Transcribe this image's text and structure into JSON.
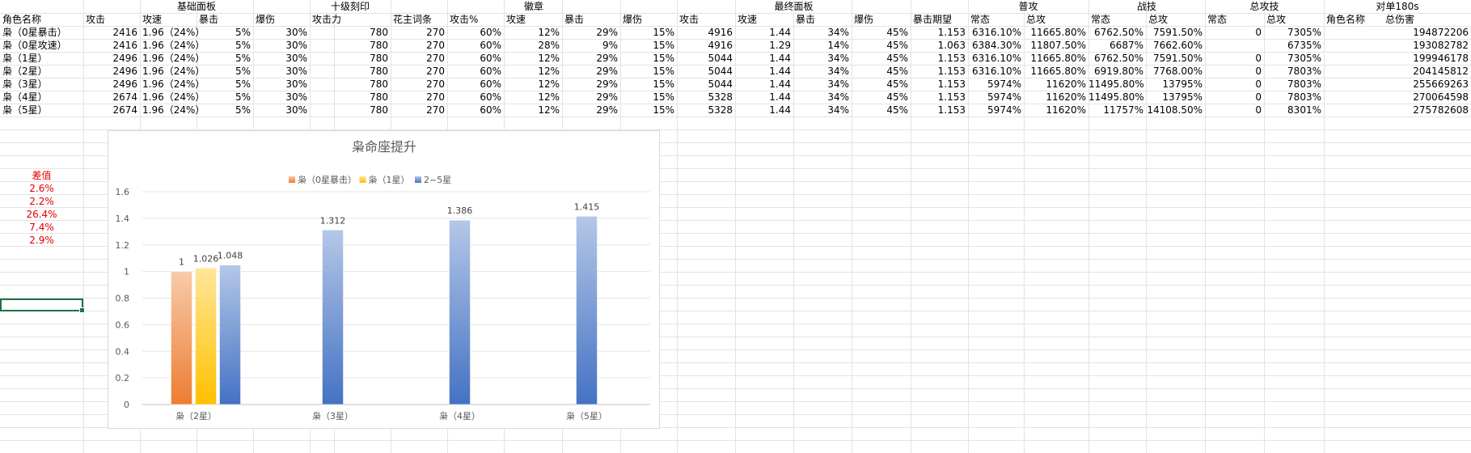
{
  "headers_top": [
    {
      "label": "基础面板",
      "col": 1,
      "span": 4
    },
    {
      "label": "十级刻印",
      "col": 5,
      "span": 1
    },
    {
      "label": "徽章",
      "col": 6,
      "span": 5
    },
    {
      "label": "最终面板",
      "col": 11,
      "span": 4
    },
    {
      "label": "普攻",
      "col": 16,
      "span": 2
    },
    {
      "label": "战技",
      "col": 18,
      "span": 2
    },
    {
      "label": "总攻技",
      "col": 20,
      "span": 2
    },
    {
      "label": "对单180s",
      "col": 22,
      "span": 2
    }
  ],
  "headers_sub": [
    "角色名称",
    "攻击",
    "攻速",
    "暴击",
    "爆伤",
    "攻击力",
    "花主词条",
    "攻击%",
    "攻速",
    "暴击",
    "爆伤",
    "攻击",
    "攻速",
    "暴击",
    "爆伤",
    "暴击期望",
    "常态",
    "总攻",
    "常态",
    "总攻",
    "常态",
    "总攻",
    "角色名称",
    "总伤害"
  ],
  "rows": [
    [
      "枭（0星暴击）",
      "2416",
      "1.96（24%）",
      "5%",
      "30%",
      "780",
      "270",
      "60%",
      "12%",
      "29%",
      "15%",
      "4916",
      "1.44",
      "34%",
      "45%",
      "1.153",
      "6316.10%",
      "11665.80%",
      "6762.50%",
      "7591.50%",
      "0",
      "7305%",
      "",
      "194872206"
    ],
    [
      "枭（0星攻速）",
      "2416",
      "1.96（24%）",
      "5%",
      "30%",
      "780",
      "270",
      "60%",
      "28%",
      "9%",
      "15%",
      "4916",
      "1.29",
      "14%",
      "45%",
      "1.063",
      "6384.30%",
      "11807.50%",
      "6687%",
      "7662.60%",
      "",
      "6735%",
      "",
      "193082782"
    ],
    [
      "枭（1星）",
      "2496",
      "1.96（24%）",
      "5%",
      "30%",
      "780",
      "270",
      "60%",
      "12%",
      "29%",
      "15%",
      "5044",
      "1.44",
      "34%",
      "45%",
      "1.153",
      "6316.10%",
      "11665.80%",
      "6762.50%",
      "7591.50%",
      "0",
      "7305%",
      "",
      "199946178"
    ],
    [
      "枭（2星）",
      "2496",
      "1.96（24%）",
      "5%",
      "30%",
      "780",
      "270",
      "60%",
      "12%",
      "29%",
      "15%",
      "5044",
      "1.44",
      "34%",
      "45%",
      "1.153",
      "6316.10%",
      "11665.80%",
      "6919.80%",
      "7768.00%",
      "0",
      "7803%",
      "",
      "204145812"
    ],
    [
      "枭（3星）",
      "2496",
      "1.96（24%）",
      "5%",
      "30%",
      "780",
      "270",
      "60%",
      "12%",
      "29%",
      "15%",
      "5044",
      "1.44",
      "34%",
      "45%",
      "1.153",
      "5974%",
      "11620%",
      "11495.80%",
      "13795%",
      "0",
      "7803%",
      "",
      "255669263"
    ],
    [
      "枭（4星）",
      "2674",
      "1.96（24%）",
      "5%",
      "30%",
      "780",
      "270",
      "60%",
      "12%",
      "29%",
      "15%",
      "5328",
      "1.44",
      "34%",
      "45%",
      "1.153",
      "5974%",
      "11620%",
      "11495.80%",
      "13795%",
      "0",
      "7803%",
      "",
      "270064598"
    ],
    [
      "枭（5星）",
      "2674",
      "1.96（24%）",
      "5%",
      "30%",
      "780",
      "270",
      "60%",
      "12%",
      "29%",
      "15%",
      "5328",
      "1.44",
      "34%",
      "45%",
      "1.153",
      "5974%",
      "11620%",
      "11757%",
      "14108.50%",
      "0",
      "8301%",
      "",
      "275782608"
    ]
  ],
  "diff": {
    "title": "差值",
    "values": [
      "2.6%",
      "2.2%",
      "26.4%",
      "7.4%",
      "2.9%"
    ]
  },
  "colors": {
    "accent_red": "#e00000",
    "selection": "#1e7145",
    "bar_orange": "#ed7d31",
    "bar_gold": "#ffc000",
    "bar_blue": "#4472c4"
  },
  "chart_data": {
    "type": "bar",
    "title": "枭命座提升",
    "categories": [
      "枭（2星）",
      "枭（3星）",
      "枭（4星）",
      "枭（5星）"
    ],
    "series": [
      {
        "name": "枭（0星暴击）",
        "values": [
          1,
          null,
          null,
          null
        ]
      },
      {
        "name": "枭（1星）",
        "values": [
          1.026,
          null,
          null,
          null
        ]
      },
      {
        "name": "2~5星",
        "values": [
          1.048,
          1.312,
          1.386,
          1.415
        ]
      }
    ],
    "ylim": [
      0,
      1.6
    ],
    "yticks": [
      "0",
      "0.2",
      "0.4",
      "0.6",
      "0.8",
      "1",
      "1.2",
      "1.4",
      "1.6"
    ],
    "grid": true,
    "legend_position": "top"
  }
}
